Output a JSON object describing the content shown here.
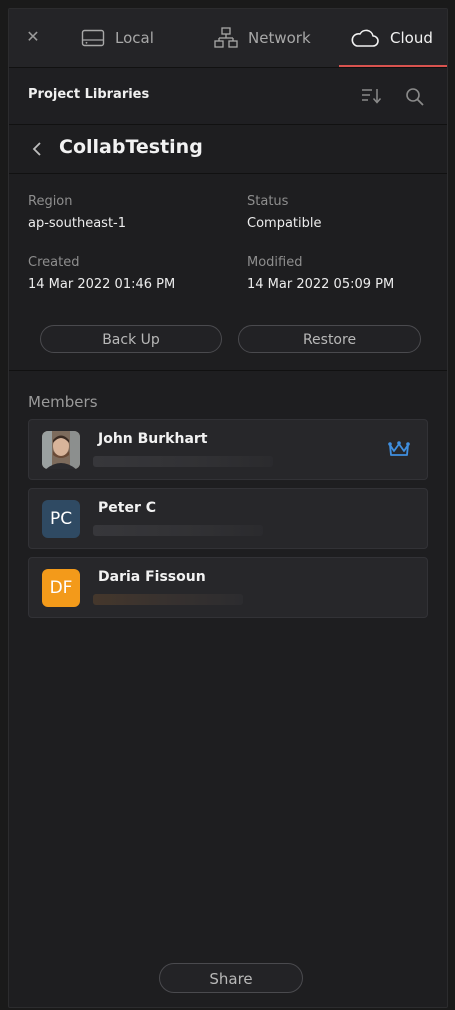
{
  "tabs": [
    {
      "label": "Local",
      "icon": "drive-icon",
      "active": false
    },
    {
      "label": "Network",
      "icon": "network-icon",
      "active": false
    },
    {
      "label": "Cloud",
      "icon": "cloud-icon",
      "active": true
    }
  ],
  "close_icon": "close-icon",
  "header": {
    "title": "Project Libraries",
    "sort_icon": "sort-icon",
    "search_icon": "search-icon"
  },
  "breadcrumb": {
    "back_icon": "chevron-left-icon",
    "title": "CollabTesting"
  },
  "details": {
    "region_label": "Region",
    "region_value": "ap-southeast-1",
    "status_label": "Status",
    "status_value": "Compatible",
    "created_label": "Created",
    "created_value": "14 Mar 2022 01:46 PM",
    "modified_label": "Modified",
    "modified_value": "14 Mar 2022 05:09 PM"
  },
  "actions": {
    "backup_label": "Back Up",
    "restore_label": "Restore"
  },
  "members": {
    "label": "Members",
    "items": [
      {
        "name": "John Burkhart",
        "avatar": "photo",
        "owner": true
      },
      {
        "name": "Peter C",
        "initials": "PC",
        "avatar_color": "#2f4a63"
      },
      {
        "name": "Daria Fissoun",
        "initials": "DF",
        "avatar_color": "#f39a1a"
      }
    ]
  },
  "share_label": "Share",
  "colors": {
    "accent_underline": "#d9534f",
    "crown": "#3f8fe0"
  }
}
